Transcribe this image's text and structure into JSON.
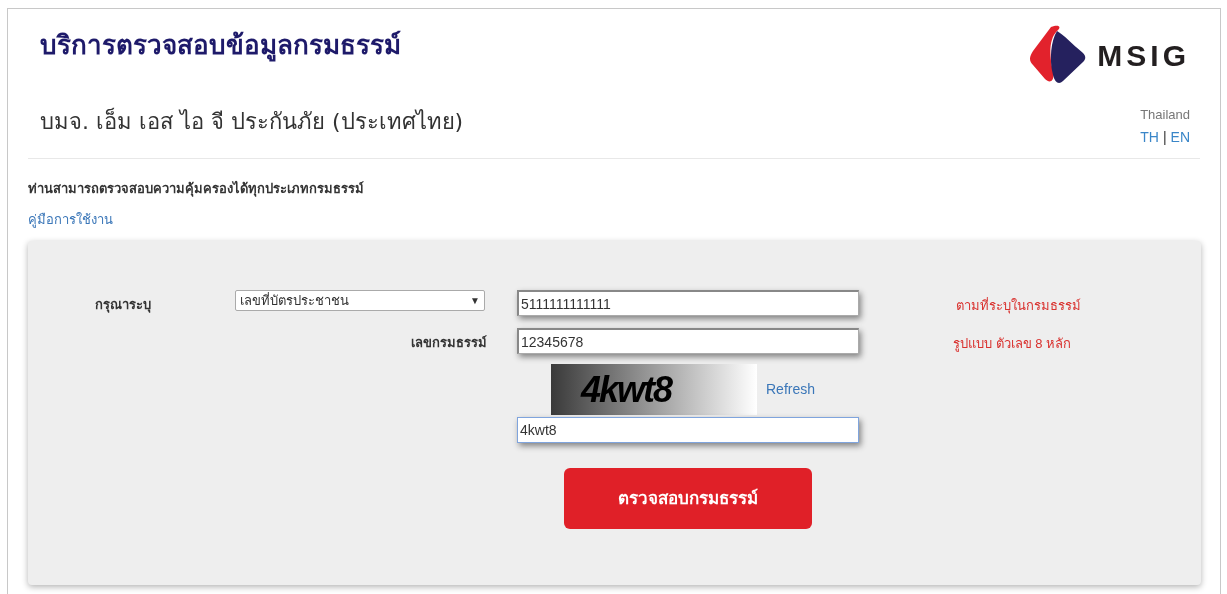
{
  "header": {
    "title": "บริการตรวจสอบข้อมูลกรมธรรม์",
    "company": "บมจ. เอ็ม เอส ไอ จี ประกันภัย (ประเทศไทย)",
    "logo_text": "MSIG",
    "region": "Thailand",
    "languages": [
      "TH",
      "EN"
    ],
    "language_separator": "|"
  },
  "intro": "ท่านสามารถตรวจสอบความคุ้มครองได้ทุกประเภทกรมธรรม์",
  "manual_link": "คู่มือการใช้งาน",
  "form": {
    "id_row": {
      "label": "กรุณาระบุ",
      "select_value": "เลขที่บัตรประชาชน",
      "select_arrow": "▼",
      "value": "5111111111111",
      "hint": "ตามที่ระบุในกรมธรรม์"
    },
    "policy_row": {
      "label": "เลขกรมธรรม์",
      "value": "12345678",
      "hint": "รูปแบบ ตัวเลข 8 หลัก"
    },
    "captcha": {
      "text": "4kwt8",
      "refresh": "Refresh",
      "value": "4kwt8",
      "focused": true
    },
    "submit": "ตรวจสอบกรมธรรม์"
  }
}
